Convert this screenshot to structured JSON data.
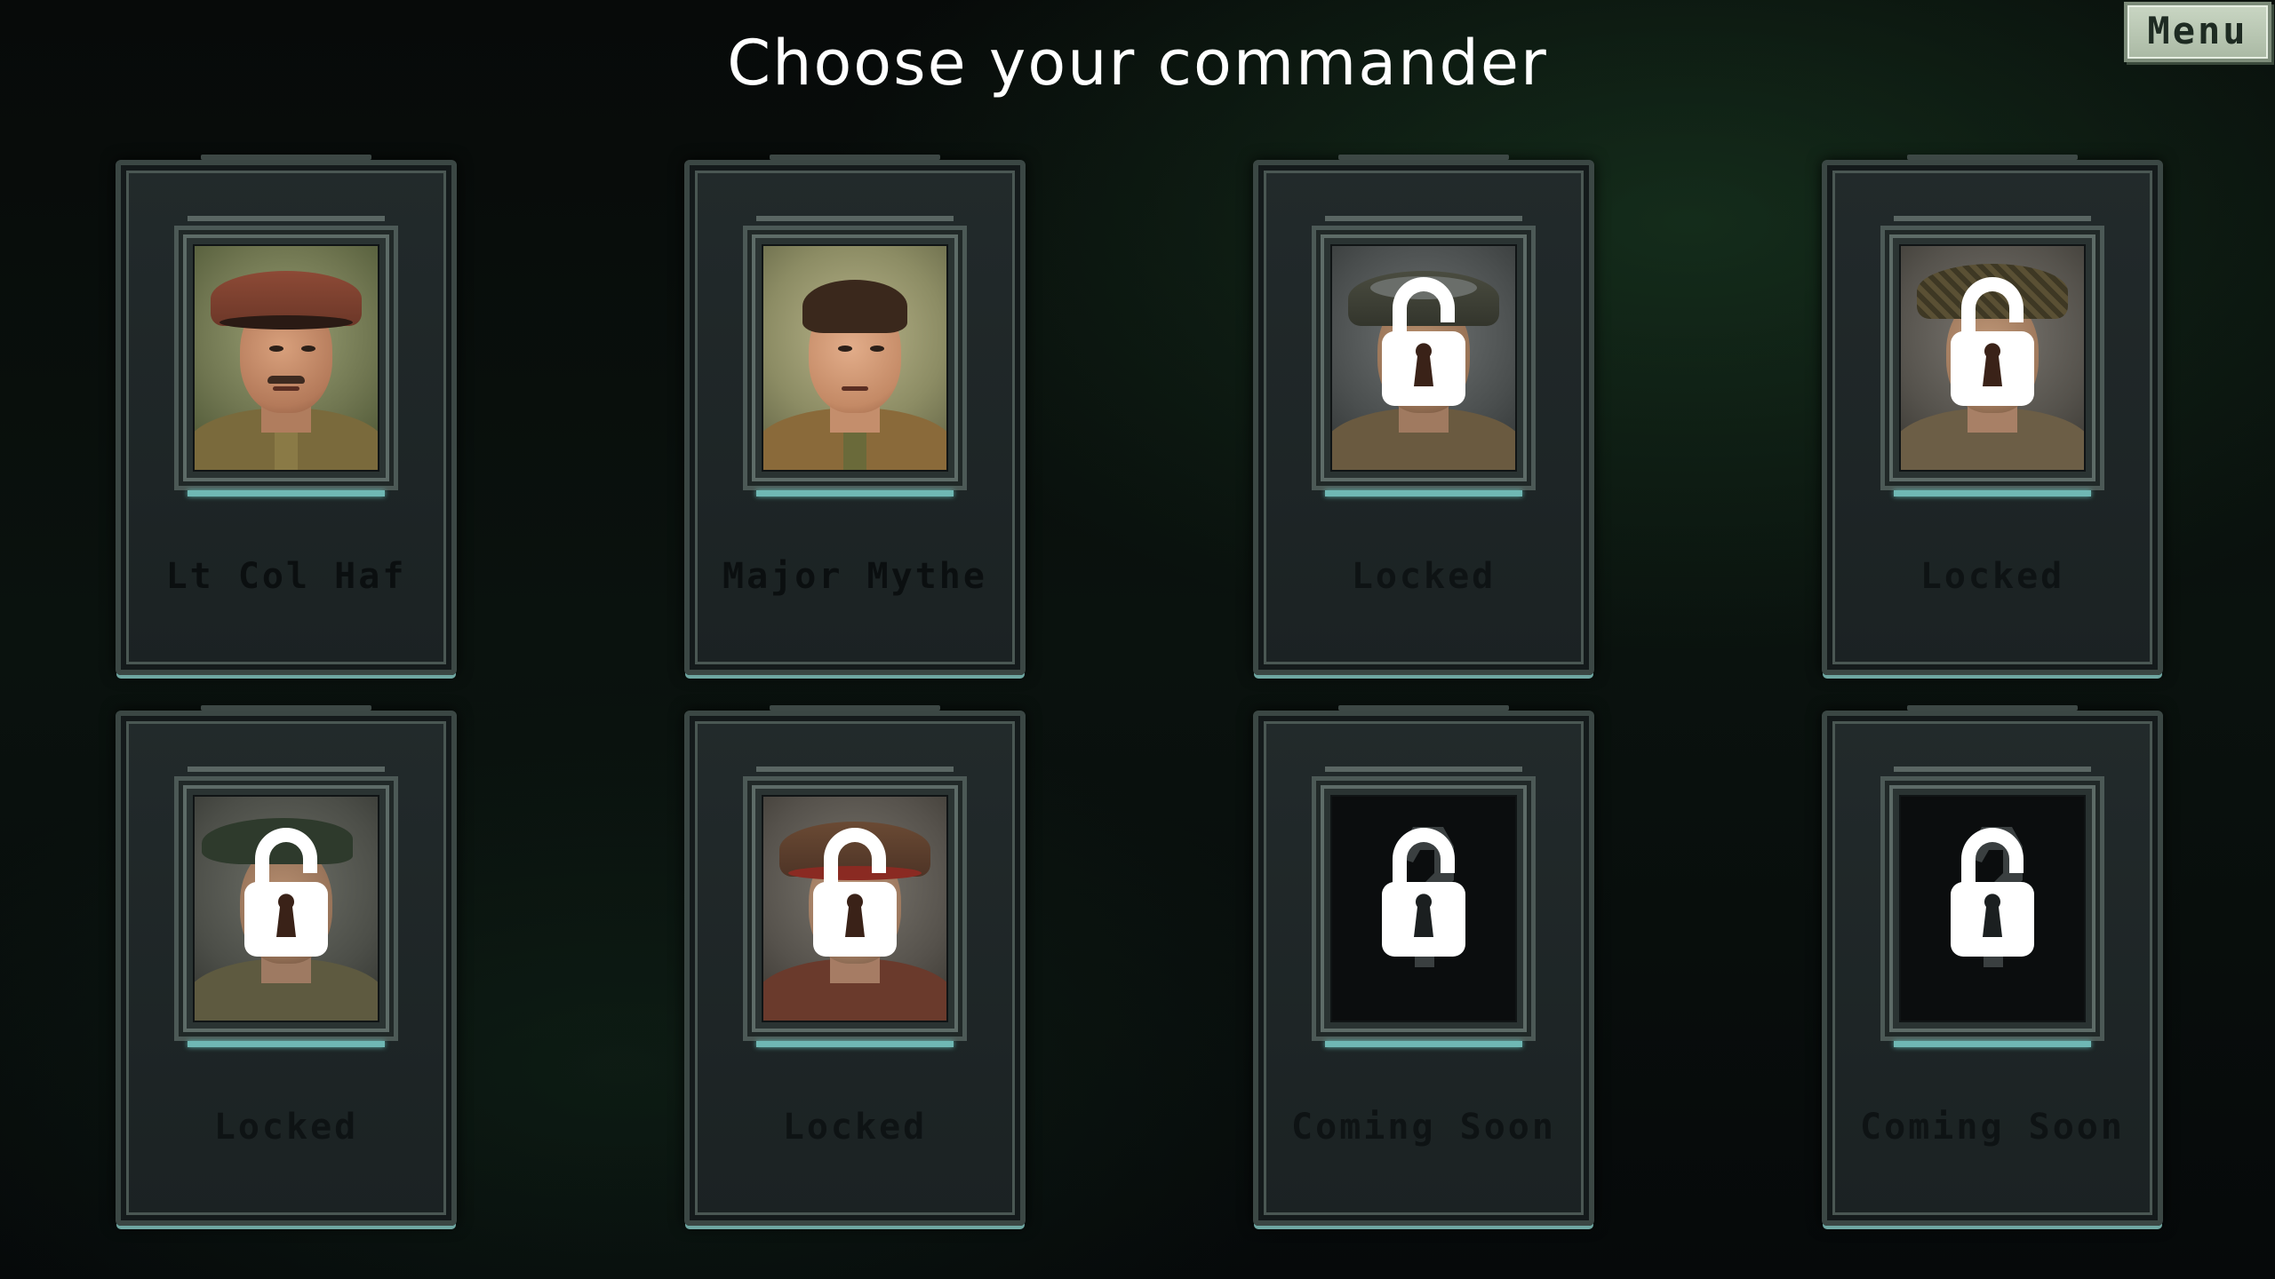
{
  "header": {
    "title": "Choose your commander",
    "menu_label": "Menu"
  },
  "commanders": [
    {
      "label": "Lt Col Haf",
      "status": "unlocked",
      "portrait": "officer-peaked-cap-mustache"
    },
    {
      "label": "Major Mythe",
      "status": "unlocked",
      "portrait": "officer-bare-head"
    },
    {
      "label": "Locked",
      "status": "locked",
      "portrait": "soldier-goggles-helmet",
      "icon": "lock-icon"
    },
    {
      "label": "Locked",
      "status": "locked",
      "portrait": "soldier-camouflage-helmet",
      "icon": "lock-icon"
    },
    {
      "label": "Locked",
      "status": "locked",
      "portrait": "soldier-beret",
      "icon": "lock-icon"
    },
    {
      "label": "Locked",
      "status": "locked",
      "portrait": "officer-red-peaked-cap",
      "icon": "lock-icon"
    },
    {
      "label": "Coming Soon",
      "status": "coming-soon",
      "portrait": "empty-question-mark",
      "icon": "lock-icon"
    },
    {
      "label": "Coming Soon",
      "status": "coming-soon",
      "portrait": "empty-question-mark",
      "icon": "lock-icon"
    }
  ],
  "colors": {
    "accent_cyan": "#6fb8b4",
    "card_bg": "#1f2627",
    "label_dark": "#0b0f10",
    "menu_bg": "#b8c6b2"
  }
}
